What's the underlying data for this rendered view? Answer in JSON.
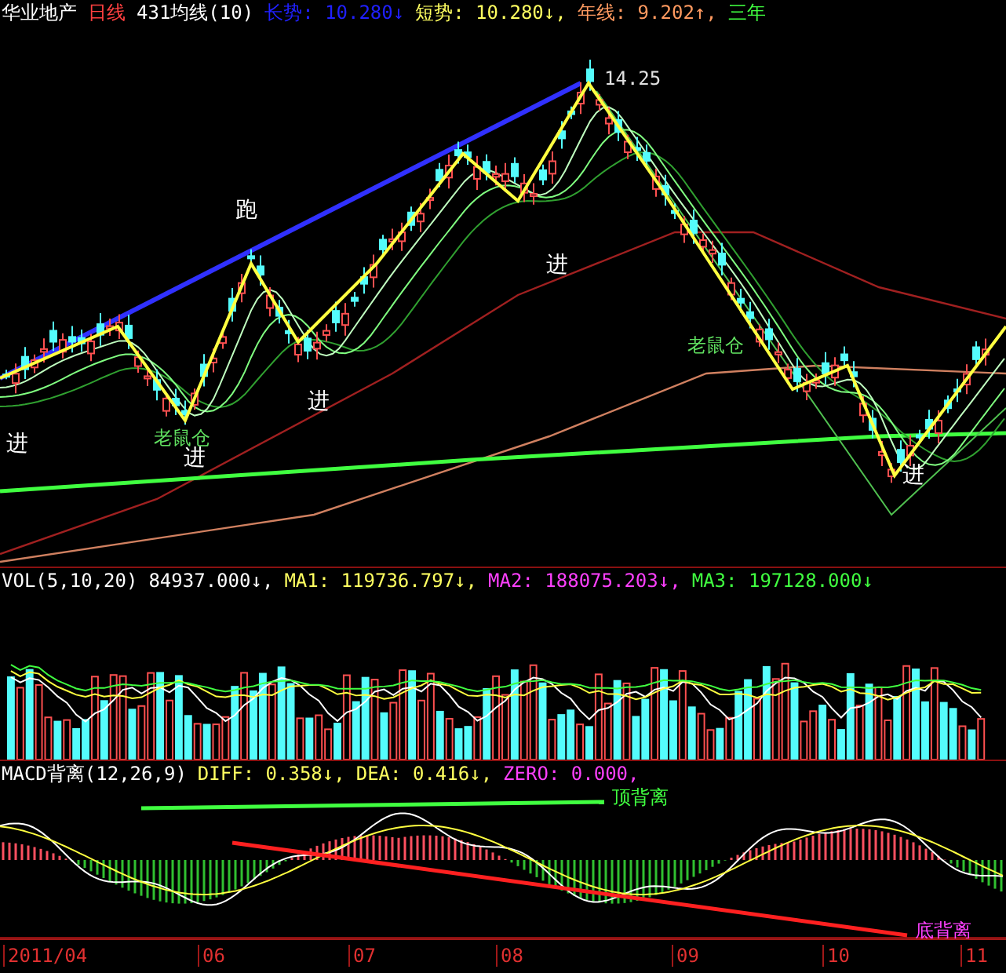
{
  "main_panel": {
    "header": [
      {
        "text": "华业地产",
        "color": "#ffffff"
      },
      {
        "text": "日线",
        "color": "#ff4040"
      },
      {
        "text": "431均线(10)",
        "color": "#ffffff"
      },
      {
        "text": "长势: 10.280↓",
        "color": "#2020ff"
      },
      {
        "text": "短势: 10.280↓,",
        "color": "#ffff60"
      },
      {
        "text": "年线: 9.202↑,",
        "color": "#ff9a60"
      },
      {
        "text": "三年",
        "color": "#40ff40"
      }
    ],
    "price_marker": "14.25",
    "annotations": [
      {
        "text": "进",
        "kind": "signal"
      },
      {
        "text": "老鼠仓",
        "kind": "note"
      },
      {
        "text": "进",
        "kind": "signal"
      },
      {
        "text": "跑",
        "kind": "signal"
      },
      {
        "text": "进",
        "kind": "signal"
      },
      {
        "text": "进",
        "kind": "signal"
      },
      {
        "text": "老鼠仓",
        "kind": "note"
      },
      {
        "text": "进",
        "kind": "signal"
      }
    ]
  },
  "volume_panel": {
    "header": [
      {
        "text": "VOL(5,10,20)",
        "color": "#ffffff"
      },
      {
        "text": "84937.000↓,",
        "color": "#ffffff"
      },
      {
        "text": "MA1: 119736.797↓,",
        "color": "#ffff60"
      },
      {
        "text": "MA2: 188075.203↓,",
        "color": "#ff40ff"
      },
      {
        "text": "MA3: 197128.000↓",
        "color": "#40ff40"
      }
    ]
  },
  "macd_panel": {
    "header": [
      {
        "text": "MACD背离(12,26,9)",
        "color": "#ffffff"
      },
      {
        "text": "DIFF: 0.358↓,",
        "color": "#ffff60"
      },
      {
        "text": "DEA: 0.416↓,",
        "color": "#ffff60"
      },
      {
        "text": "ZERO: 0.000,",
        "color": "#ff40ff"
      }
    ],
    "annotations": [
      {
        "text": "顶背离",
        "color": "#40ff40"
      },
      {
        "text": "底背离",
        "color": "#ff40ff"
      }
    ]
  },
  "time_axis": [
    "2011/04",
    "06",
    "07",
    "08",
    "09",
    "10",
    "11"
  ]
}
